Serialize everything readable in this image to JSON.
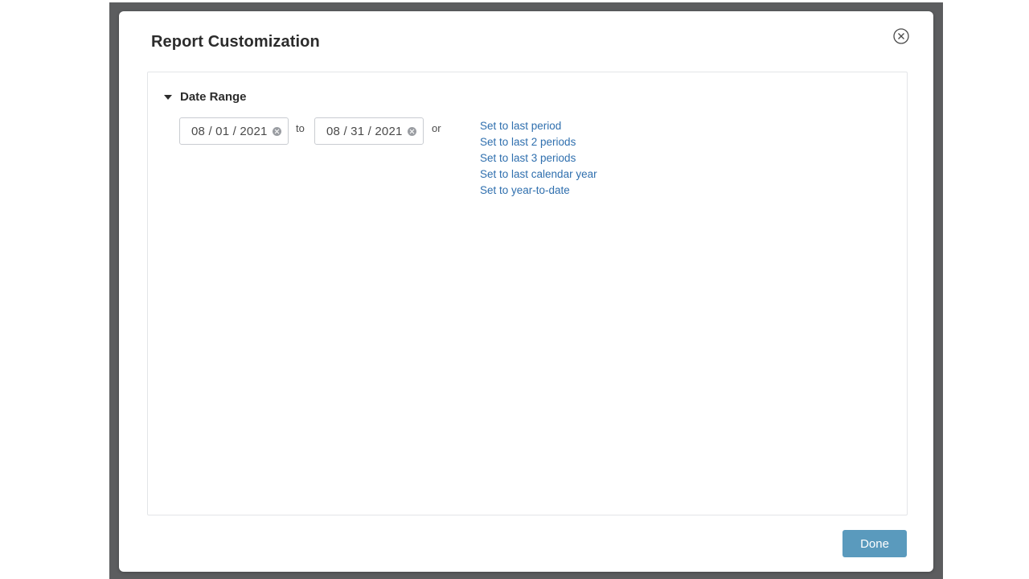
{
  "dialog": {
    "title": "Report Customization",
    "close_icon": "close-circle-icon"
  },
  "date_range": {
    "section_label": "Date Range",
    "caret_icon": "caret-down-icon",
    "start_date": "08 / 01 / 2021",
    "end_date": "08 / 31 / 2021",
    "separator_to": "to",
    "separator_or": "or",
    "presets": [
      "Set to last period",
      "Set to last 2 periods",
      "Set to last 3 periods",
      "Set to last calendar year",
      "Set to year-to-date"
    ]
  },
  "footer": {
    "done_label": "Done"
  },
  "colors": {
    "overlay": "#5c5d5f",
    "link": "#2f6fae",
    "primary_button": "#5a9abd"
  }
}
